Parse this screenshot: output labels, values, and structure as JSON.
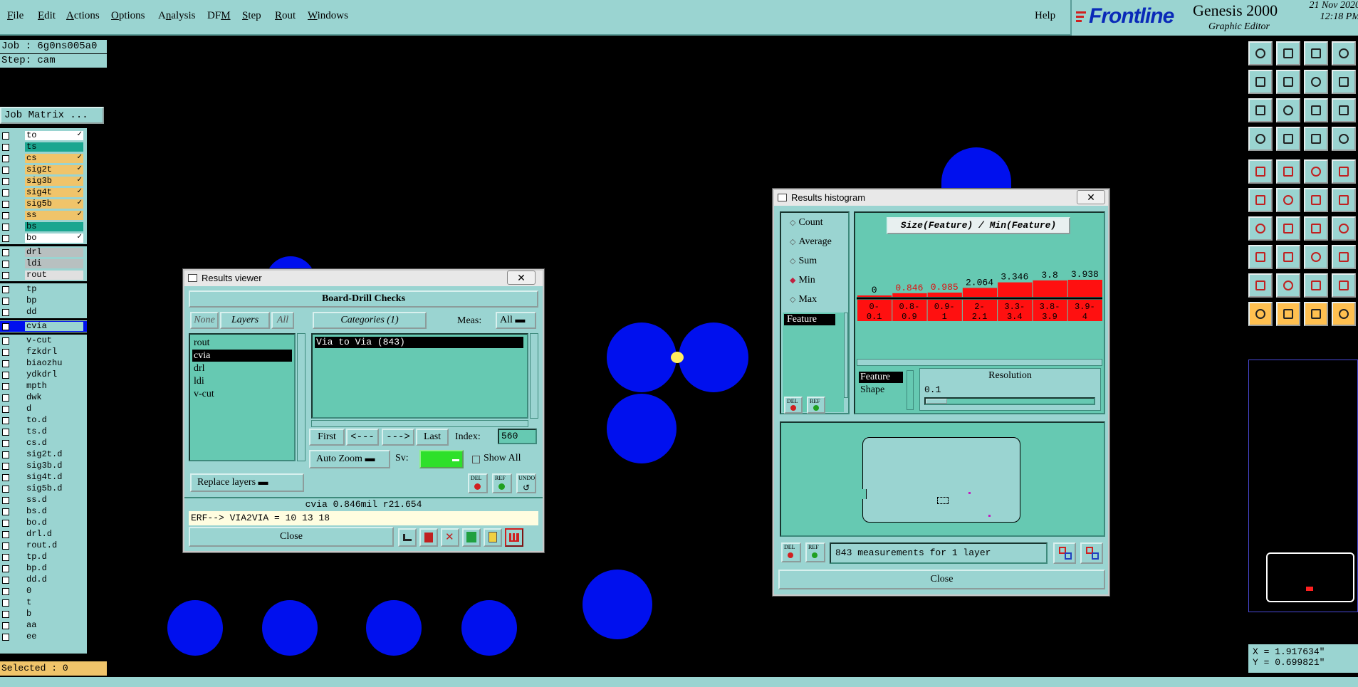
{
  "menu": [
    {
      "pre": "",
      "u": "F",
      "post": "ile"
    },
    {
      "pre": "",
      "u": "E",
      "post": "dit"
    },
    {
      "pre": "",
      "u": "A",
      "post": "ctions"
    },
    {
      "pre": "",
      "u": "O",
      "post": "ptions"
    },
    {
      "pre": "A",
      "u": "n",
      "post": "alysis"
    },
    {
      "pre": "DF",
      "u": "M",
      "post": ""
    },
    {
      "pre": "",
      "u": "S",
      "post": "tep"
    },
    {
      "pre": "",
      "u": "R",
      "post": "out"
    },
    {
      "pre": "",
      "u": "W",
      "post": "indows"
    }
  ],
  "help_label": "Help",
  "brand": {
    "logo": "Frontline",
    "product": "Genesis 2000",
    "subtitle": "Graphic Editor",
    "date": "21 Nov 2020",
    "time": "12:18 PM",
    "logo_color": "#0a2ab8"
  },
  "job": {
    "job_line": "Job : 6g0ns005a0",
    "step_line": "Step: cam",
    "matrix_button": "Job Matrix ..."
  },
  "layers": [
    {
      "name": "to",
      "color": "#ffffff",
      "arrow": true
    },
    {
      "name": "ts",
      "color": "#1aa690",
      "arrow": false
    },
    {
      "name": "cs",
      "color": "#f0c46a",
      "arrow": true
    },
    {
      "name": "sig2t",
      "color": "#f0c46a",
      "arrow": true
    },
    {
      "name": "sig3b",
      "color": "#f0c46a",
      "arrow": true
    },
    {
      "name": "sig4t",
      "color": "#f0c46a",
      "arrow": true
    },
    {
      "name": "sig5b",
      "color": "#f0c46a",
      "arrow": true
    },
    {
      "name": "ss",
      "color": "#f0c46a",
      "arrow": true
    },
    {
      "name": "bs",
      "color": "#1aa690",
      "arrow": false
    },
    {
      "name": "bo",
      "color": "#ffffff",
      "arrow": true
    },
    {
      "name": "drl",
      "color": "#b8c0c0",
      "arrow": false,
      "sep": true
    },
    {
      "name": "ldi",
      "color": "#b8c0c0",
      "arrow": false
    },
    {
      "name": "rout",
      "color": "#e0e0e0",
      "arrow": false
    },
    {
      "name": "tp",
      "color": "#9ad4d1",
      "arrow": false,
      "sep": true
    },
    {
      "name": "bp",
      "color": "#9ad4d1",
      "arrow": false
    },
    {
      "name": "dd",
      "color": "#9ad4d1",
      "arrow": false
    },
    {
      "name": "cvia",
      "color": "#9ad4d1",
      "arrow": false,
      "sep": true,
      "active": true
    },
    {
      "name": "v-cut",
      "color": "#9ad4d1",
      "arrow": false,
      "sep": true
    },
    {
      "name": "fzkdrl",
      "color": "#9ad4d1",
      "arrow": false
    },
    {
      "name": "biaozhu",
      "color": "#9ad4d1",
      "arrow": false
    },
    {
      "name": "ydkdrl",
      "color": "#9ad4d1",
      "arrow": false
    },
    {
      "name": "mpth",
      "color": "#9ad4d1",
      "arrow": false
    },
    {
      "name": "dwk",
      "color": "#9ad4d1",
      "arrow": false
    },
    {
      "name": "d",
      "color": "#9ad4d1",
      "arrow": false
    },
    {
      "name": "to.d",
      "color": "#9ad4d1",
      "arrow": false
    },
    {
      "name": "ts.d",
      "color": "#9ad4d1",
      "arrow": false
    },
    {
      "name": "cs.d",
      "color": "#9ad4d1",
      "arrow": false
    },
    {
      "name": "sig2t.d",
      "color": "#9ad4d1",
      "arrow": false
    },
    {
      "name": "sig3b.d",
      "color": "#9ad4d1",
      "arrow": false
    },
    {
      "name": "sig4t.d",
      "color": "#9ad4d1",
      "arrow": false
    },
    {
      "name": "sig5b.d",
      "color": "#9ad4d1",
      "arrow": false
    },
    {
      "name": "ss.d",
      "color": "#9ad4d1",
      "arrow": false
    },
    {
      "name": "bs.d",
      "color": "#9ad4d1",
      "arrow": false
    },
    {
      "name": "bo.d",
      "color": "#9ad4d1",
      "arrow": false
    },
    {
      "name": "drl.d",
      "color": "#9ad4d1",
      "arrow": false
    },
    {
      "name": "rout.d",
      "color": "#9ad4d1",
      "arrow": false
    },
    {
      "name": "tp.d",
      "color": "#9ad4d1",
      "arrow": false
    },
    {
      "name": "bp.d",
      "color": "#9ad4d1",
      "arrow": false
    },
    {
      "name": "dd.d",
      "color": "#9ad4d1",
      "arrow": false
    },
    {
      "name": "0",
      "color": "#9ad4d1",
      "arrow": false
    },
    {
      "name": "t",
      "color": "#9ad4d1",
      "arrow": false
    },
    {
      "name": "b",
      "color": "#9ad4d1",
      "arrow": false
    },
    {
      "name": "aa",
      "color": "#9ad4d1",
      "arrow": false
    },
    {
      "name": "ee",
      "color": "#9ad4d1",
      "arrow": false
    }
  ],
  "selected_text": "Selected : 0",
  "viewer": {
    "title": "Results viewer",
    "header": "Board-Drill Checks",
    "none_label": "None",
    "layers_label": "Layers",
    "all_label": "All",
    "categories_label": "Categories (1)",
    "meas_label": "Meas:",
    "meas_value": "All",
    "layer_list": [
      "rout",
      "cvia",
      "drl",
      "ldi",
      "v-cut"
    ],
    "selected_layer": "cvia",
    "category_item": "Via to Via  (843)",
    "first_label": "First",
    "prev_label": "<---",
    "next_label": "--->",
    "last_label": "Last",
    "index_label": "Index:",
    "index_value": "560",
    "replace_label": "Replace layers",
    "autozoom_label": "Auto Zoom",
    "sv_label": "Sv:",
    "showall_label": "Show All",
    "del_label": "DEL",
    "ref_label": "REF",
    "undo_label": "UNDO",
    "info_line": "cvia 0.846mil  r21.654",
    "erf_line": "ERF--> VIA2VIA = 10 13 18",
    "close_label": "Close"
  },
  "histogram": {
    "title": "Results histogram",
    "options": [
      "Count",
      "Average",
      "Sum",
      "Min",
      "Max"
    ],
    "selected_option": "Min",
    "graph_title": "Size(Feature) / Min(Feature)",
    "feature_label": "Feature",
    "feature_list": [
      "Feature",
      "Shape"
    ],
    "resolution_label": "Resolution",
    "resolution_value": "0.1",
    "del_label": "DEL",
    "ref_label": "REF",
    "measurements_text": "843 measurements for 1 layer",
    "close_label": "Close"
  },
  "chart_data": {
    "type": "bar",
    "title": "Size(Feature) / Min(Feature)",
    "categories": [
      "0-0.1",
      "0.8-0.9",
      "0.9-1",
      "2-2.1",
      "3.3-3.4",
      "3.8-3.9",
      "3.9-4"
    ],
    "values": [
      0,
      0.846,
      0.985,
      2.064,
      3.346,
      3.8,
      3.938
    ],
    "labels": [
      "0",
      "0.846",
      "0.985",
      "2.064",
      "3.346",
      "3.8",
      "3.938"
    ],
    "ylim": [
      0,
      3.938
    ],
    "bar_color": "#ff1010",
    "highlight_color": "#e01010"
  },
  "coords": {
    "x": "X = 1.917634\"",
    "y": "Y = 0.699821\""
  }
}
